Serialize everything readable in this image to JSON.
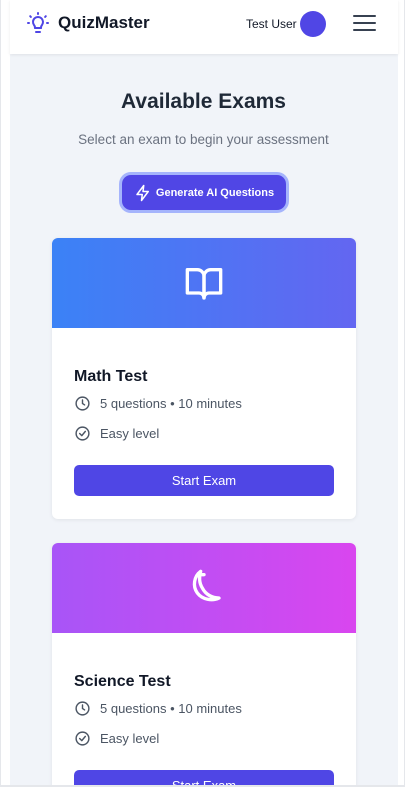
{
  "header": {
    "app_title": "QuizMaster",
    "user_name": "Test User",
    "logo_icon": "lightbulb-icon",
    "menu_icon": "hamburger-menu-icon"
  },
  "main": {
    "title": "Available Exams",
    "subtitle": "Select an exam to begin your assessment",
    "ai_button_label": "Generate AI Questions",
    "ai_button_icon": "lightning-icon"
  },
  "exams": [
    {
      "title": "Math Test",
      "meta_questions": "5 questions • 10 minutes",
      "meta_level": "Easy level",
      "button_label": "Start Exam",
      "banner_icon": "book-open-icon"
    },
    {
      "title": "Science Test",
      "meta_questions": "5 questions • 10 minutes",
      "meta_level": "Easy level",
      "button_label": "Start Exam",
      "banner_icon": "moon-icon"
    }
  ],
  "colors": {
    "accent": "#4f46e5",
    "page_bg": "#f1f4f9",
    "math_banner": "#3b82f6",
    "science_banner": "#c04cf0"
  }
}
